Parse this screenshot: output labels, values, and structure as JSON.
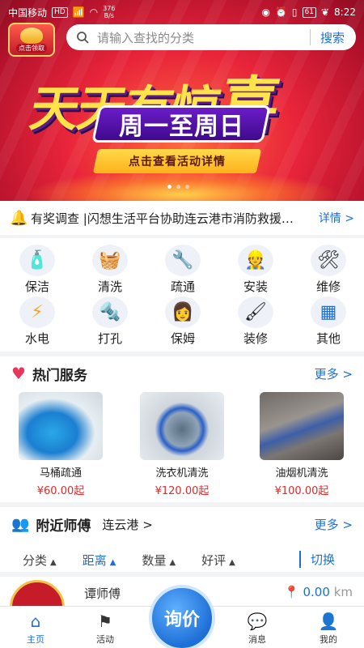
{
  "status_bar": {
    "carrier": "中国移动",
    "hd": "HD",
    "signal": "4G",
    "speed_value": "376",
    "speed_unit": "B/s",
    "battery": "61",
    "time": "8:22"
  },
  "banner": {
    "logo_label": "点击领取",
    "search_placeholder": "请输入查找的分类",
    "search_button": "搜索",
    "headline_part1": "天天有惊",
    "headline_part2": "喜",
    "subtitle": "周一至周日",
    "cta": "点击查看活动详情",
    "colors": {
      "primary": "#e8243a",
      "headline": "#ffe34a",
      "accent": "#6b1cc9"
    }
  },
  "notice": {
    "text": "有奖调查 |闪想生活平台协助连云港市消防救援支队",
    "more": "详情 >"
  },
  "categories": [
    {
      "label": "保洁",
      "icon": "cleaning-bucket-icon",
      "glyph": "🧴"
    },
    {
      "label": "清洗",
      "icon": "washing-machine-icon",
      "glyph": "🧺"
    },
    {
      "label": "疏通",
      "icon": "pipe-icon",
      "glyph": "🔧"
    },
    {
      "label": "安装",
      "icon": "installer-worker-icon",
      "glyph": "👷"
    },
    {
      "label": "维修",
      "icon": "tools-icon",
      "glyph": "🛠"
    },
    {
      "label": "水电",
      "icon": "lightning-icon",
      "glyph": "⚡"
    },
    {
      "label": "打孔",
      "icon": "drill-icon",
      "glyph": "🔩"
    },
    {
      "label": "保姆",
      "icon": "nanny-icon",
      "glyph": "👩"
    },
    {
      "label": "装修",
      "icon": "paint-roller-icon",
      "glyph": "🖌"
    },
    {
      "label": "其他",
      "icon": "grid-icon",
      "glyph": "▦"
    }
  ],
  "hot_services": {
    "title": "热门服务",
    "more": "更多 >",
    "items": [
      {
        "name": "马桶疏通",
        "price": "¥60.00起"
      },
      {
        "name": "洗衣机清洗",
        "price": "¥120.00起"
      },
      {
        "name": "油烟机清洗",
        "price": "¥100.00起"
      }
    ]
  },
  "nearby": {
    "title": "附近师傅",
    "city": "连云港 >",
    "more": "更多 >",
    "filters": [
      {
        "label": "分类",
        "active": false
      },
      {
        "label": "距离",
        "active": true
      },
      {
        "label": "数量",
        "active": false
      },
      {
        "label": "好评",
        "active": false
      }
    ],
    "switch_label": "切换",
    "worker": {
      "name": "谭师傅",
      "distance": "0.00",
      "unit": "km"
    }
  },
  "tabbar": {
    "items": [
      {
        "label": "主页",
        "icon": "home-icon",
        "active": true
      },
      {
        "label": "活动",
        "icon": "flag-icon",
        "active": false
      },
      {
        "label": "消息",
        "icon": "message-icon",
        "active": false
      },
      {
        "label": "我的",
        "icon": "profile-icon",
        "active": false
      }
    ],
    "center_button": "询价"
  }
}
